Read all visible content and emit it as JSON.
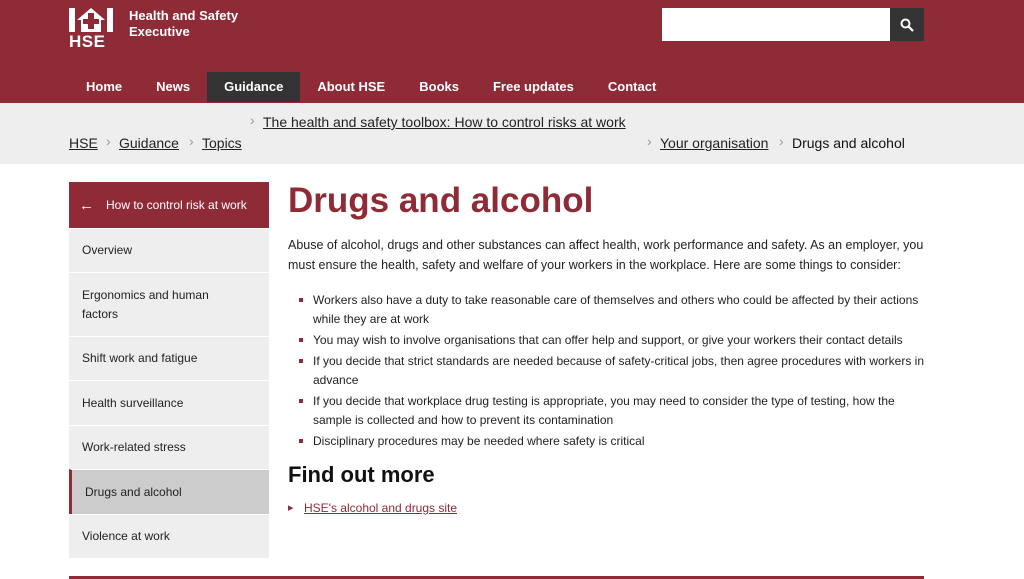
{
  "header": {
    "logo_text": "HSE",
    "org_name": "Health and Safety Executive",
    "search_placeholder": "",
    "colors": {
      "brand": "#8f2b37",
      "nav_active": "#333333",
      "crumb_bg": "#eeeeee"
    }
  },
  "nav": {
    "items": [
      {
        "label": "Home"
      },
      {
        "label": "News"
      },
      {
        "label": "Guidance",
        "active": true
      },
      {
        "label": "About HSE"
      },
      {
        "label": "Books"
      },
      {
        "label": "Free updates"
      },
      {
        "label": "Contact"
      }
    ]
  },
  "breadcrumb": {
    "parent_link": "The health and safety toolbox: How to control risks at work",
    "left": [
      "HSE",
      "Guidance",
      "Topics"
    ],
    "right_link": "Your organisation",
    "current": "Drugs and alcohol"
  },
  "sidebar": {
    "back_label": "How to control risk at work",
    "items": [
      {
        "label": "Overview"
      },
      {
        "label": "Ergonomics and human factors"
      },
      {
        "label": "Shift work and fatigue"
      },
      {
        "label": "Health surveillance"
      },
      {
        "label": "Work-related stress"
      },
      {
        "label": "Drugs and alcohol",
        "active": true
      },
      {
        "label": "Violence at work"
      }
    ]
  },
  "main": {
    "title": "Drugs and alcohol",
    "intro": "Abuse of alcohol, drugs and other substances can affect health, work performance and safety. As an employer, you must ensure the health, safety and welfare of your workers in the workplace. Here are some things to consider:",
    "bullets": [
      "Workers also have a duty to take reasonable care of themselves and others who could be affected by their actions while they are at work",
      "You may wish to involve organisations that can offer help and support, or give your workers their contact details",
      "If you decide that strict standards are needed because of safety-critical jobs, then agree procedures with workers in advance",
      "If you decide that workplace drug testing is appropriate, you may need to consider the type of testing, how the sample is collected and how to prevent its contamination",
      "Disciplinary procedures may be needed where safety is critical"
    ],
    "subtitle": "Find out more",
    "more_link": "HSE's alcohol and drugs site"
  }
}
